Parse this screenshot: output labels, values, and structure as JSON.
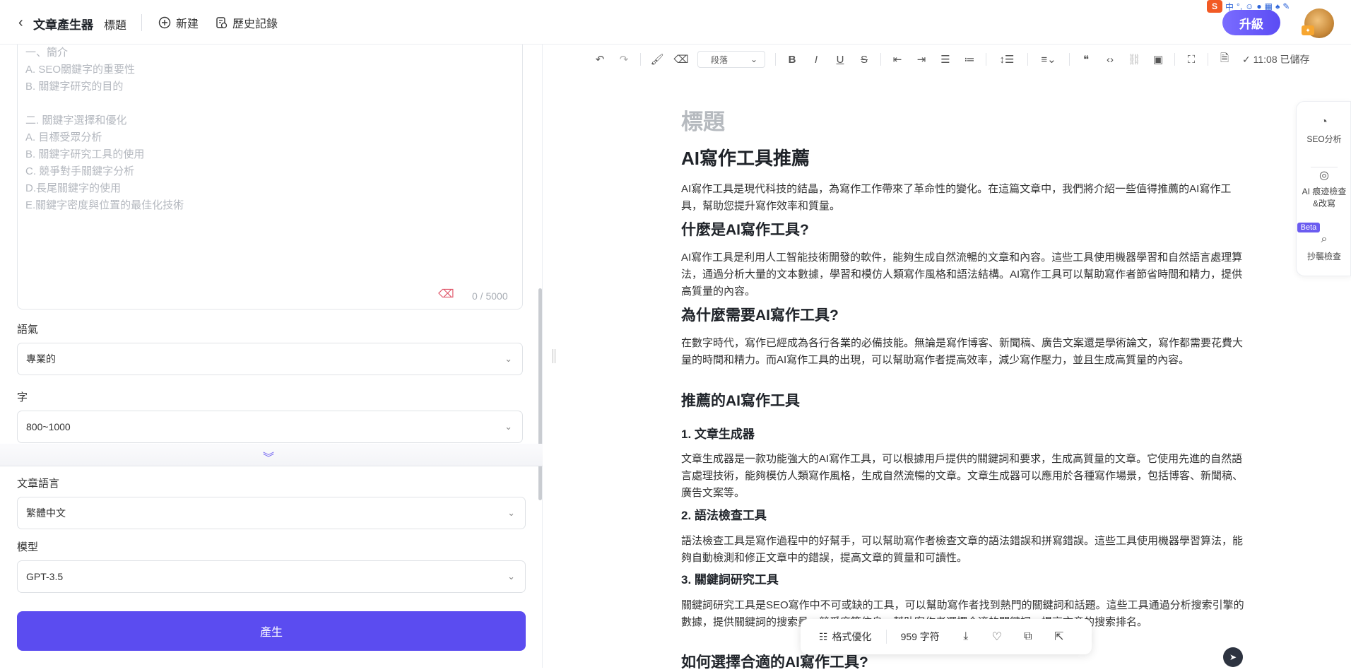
{
  "header": {
    "app_title": "文章產生器",
    "title_tab": "標題",
    "new_label": "新建",
    "history_label": "歷史記錄",
    "upgrade_label": "升級",
    "ime_lang": "中"
  },
  "left_panel": {
    "outline_lines": [
      "一、簡介",
      "A. SEO關鍵字的重要性",
      "B. 關鍵字研究的目的",
      "",
      "二. 關鍵字選擇和優化",
      "A. 目標受眾分析",
      "B. 關鍵字研究工具的使用",
      "C. 競爭對手關鍵字分析",
      "D.長尾關鍵字的使用",
      "E.關鍵字密度與位置的最佳化技術"
    ],
    "char_counter": "0 / 5000",
    "tone_label": "語氣",
    "tone_value": "專業的",
    "words_label": "字",
    "words_value": "800~1000",
    "language_label": "文章語言",
    "language_value": "繁體中文",
    "model_label": "模型",
    "model_value": "GPT-3.5",
    "generate_label": "產生"
  },
  "editor_toolbar": {
    "paragraph_label": "段落",
    "saved_status": "✓ 11:08 已儲存"
  },
  "document": {
    "title_placeholder": "標題",
    "h1": "AI寫作工具推薦",
    "p1": "AI寫作工具是現代科技的結晶，為寫作工作帶來了革命性的變化。在這篇文章中，我們將介紹一些值得推薦的AI寫作工具，幫助您提升寫作效率和質量。",
    "h2_1": "什麼是AI寫作工具?",
    "p2": "AI寫作工具是利用人工智能技術開發的軟件，能夠生成自然流暢的文章和內容。這些工具使用機器學習和自然語言處理算法，通過分析大量的文本數據，學習和模仿人類寫作風格和語法結構。AI寫作工具可以幫助寫作者節省時間和精力，提供高質量的內容。",
    "h2_2": "為什麼需要AI寫作工具?",
    "p3": "在數字時代，寫作已經成為各行各業的必備技能。無論是寫作博客、新聞稿、廣告文案還是學術論文，寫作都需要花費大量的時間和精力。而AI寫作工具的出現，可以幫助寫作者提高效率，減少寫作壓力，並且生成高質量的內容。",
    "h2_3": "推薦的AI寫作工具",
    "h3_1": "1. 文章生成器",
    "p4": "文章生成器是一款功能強大的AI寫作工具，可以根據用戶提供的關鍵詞和要求，生成高質量的文章。它使用先進的自然語言處理技術，能夠模仿人類寫作風格，生成自然流暢的文章。文章生成器可以應用於各種寫作場景，包括博客、新聞稿、廣告文案等。",
    "h3_2": "2. 語法檢查工具",
    "p5": "語法檢查工具是寫作過程中的好幫手，可以幫助寫作者檢查文章的語法錯誤和拼寫錯誤。這些工具使用機器學習算法，能夠自動檢測和修正文章中的錯誤，提高文章的質量和可讀性。",
    "h3_3": "3. 關鍵詞研究工具",
    "p6": "關鍵詞研究工具是SEO寫作中不可或缺的工具，可以幫助寫作者找到熱門的關鍵詞和話題。這些工具通過分析搜索引擎的數據，提供關鍵詞的搜索量、競爭度等信息，幫助寫作者選擇合適的關鍵詞，提高文章的搜索排名。",
    "h2_4": "如何選擇合適的AI寫作工具?"
  },
  "right_rail": {
    "seo_label": "SEO分析",
    "ai_check_label": "AI 痕迹檢查&改寫",
    "beta_label": "Beta",
    "plagiarism_label": "抄襲檢查"
  },
  "bottom_bar": {
    "format_label": "格式優化",
    "char_count": "959 字符"
  },
  "icons": [
    "chevron-left-icon",
    "plus-circle-icon",
    "history-icon",
    "undo-icon",
    "redo-icon",
    "format-painter-icon",
    "eraser-icon",
    "bold-icon",
    "italic-icon",
    "underline-icon",
    "strikethrough-icon",
    "outdent-icon",
    "indent-icon",
    "ordered-list-icon",
    "bullet-list-icon",
    "line-height-icon",
    "align-icon",
    "quote-icon",
    "code-icon",
    "link-icon",
    "image-icon",
    "fullscreen-icon",
    "save-icon",
    "gauge-icon",
    "target-icon",
    "search-doc-icon",
    "download-icon",
    "heart-icon",
    "copy-icon",
    "export-icon",
    "broom-icon"
  ]
}
